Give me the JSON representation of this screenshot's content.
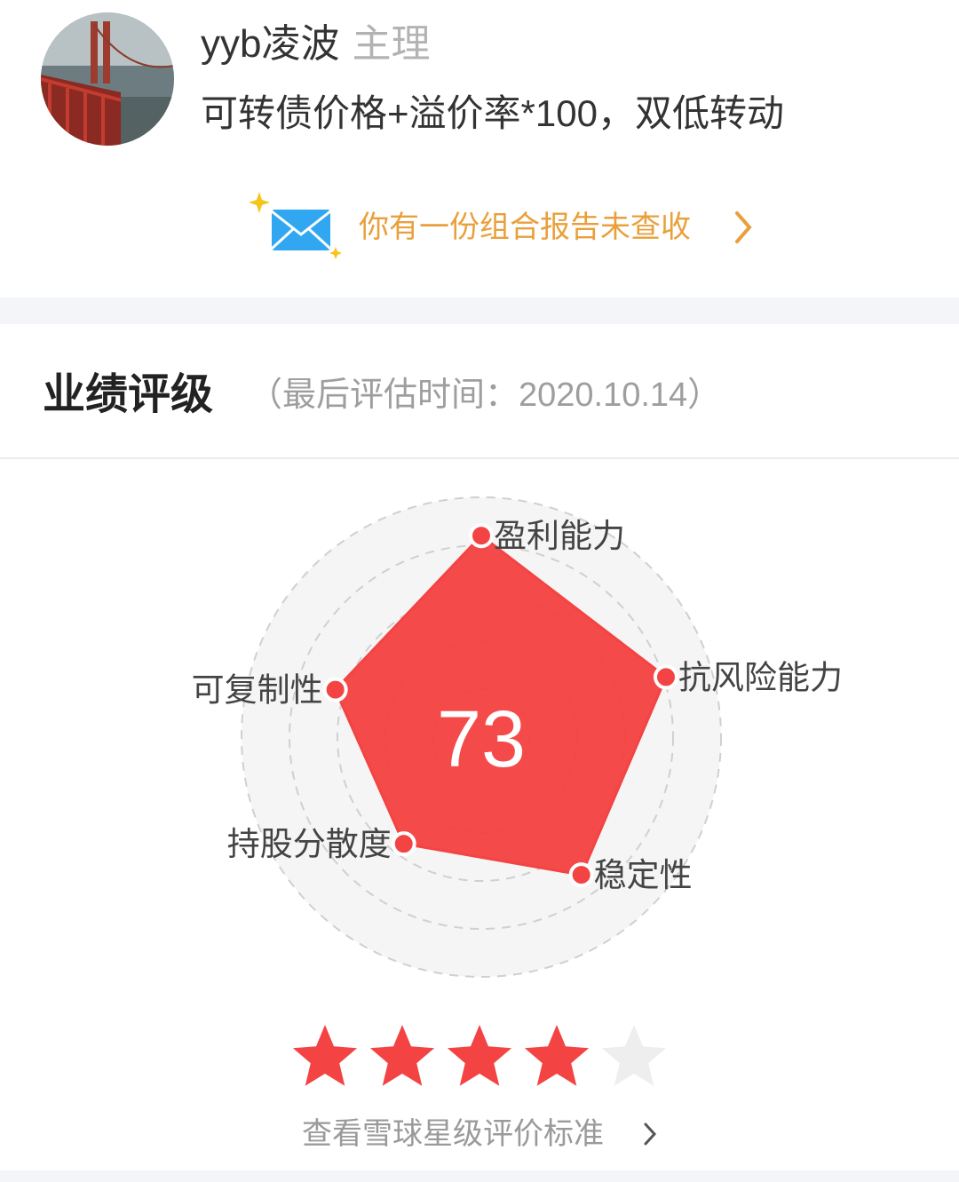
{
  "profile": {
    "username": "yyb凌波",
    "role": "主理",
    "description": "可转债价格+溢价率*100，双低转动",
    "avatar_icon": "bridge-photo-avatar"
  },
  "report": {
    "text": "你有一份组合报告未查收",
    "icon": "envelope-icon",
    "color": "#e9a03b"
  },
  "rating": {
    "title": "业绩评级",
    "subtitle": "（最后评估时间：2020.10.14）",
    "score": "73",
    "stars": 4,
    "max_stars": 5,
    "criteria_link": "查看雪球星级评价标准",
    "accent": "#f44343"
  },
  "chart_data": {
    "type": "radar",
    "categories": [
      "盈利能力",
      "抗风险能力",
      "稳定性",
      "持股分散度",
      "可复制性"
    ],
    "values": [
      0.84,
      0.81,
      0.71,
      0.55,
      0.64
    ],
    "max": 1
  }
}
